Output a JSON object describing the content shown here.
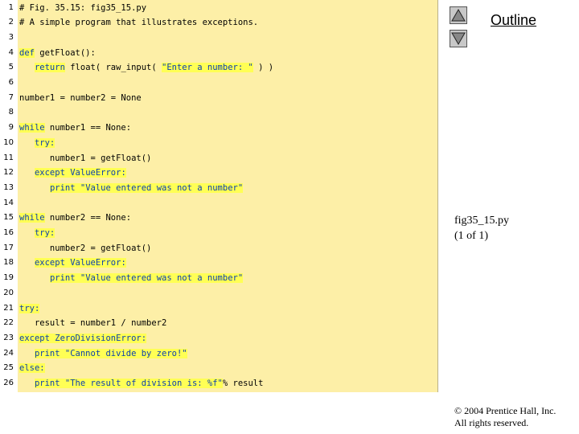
{
  "code_lines": [
    {
      "n": "1",
      "tokens": [
        {
          "t": "# Fig. 35.15: fig35_15.py",
          "c": "comment"
        }
      ]
    },
    {
      "n": "2",
      "tokens": [
        {
          "t": "# A simple program that illustrates exceptions.",
          "c": "comment"
        }
      ]
    },
    {
      "n": "3",
      "tokens": []
    },
    {
      "n": "4",
      "tokens": [
        {
          "t": "def",
          "c": "kw"
        },
        {
          "t": " getFloat():",
          "c": "plain"
        }
      ]
    },
    {
      "n": "5",
      "tokens": [
        {
          "t": "   ",
          "c": "plain"
        },
        {
          "t": "return",
          "c": "kw"
        },
        {
          "t": " float( raw_input( ",
          "c": "plain"
        },
        {
          "t": "\"Enter a number: \"",
          "c": "str"
        },
        {
          "t": " ) )",
          "c": "plain"
        }
      ]
    },
    {
      "n": "6",
      "tokens": []
    },
    {
      "n": "7",
      "tokens": [
        {
          "t": "number1 = number2 = None",
          "c": "plain"
        }
      ]
    },
    {
      "n": "8",
      "tokens": []
    },
    {
      "n": "9",
      "tokens": [
        {
          "t": "while",
          "c": "kw"
        },
        {
          "t": " number1 == None:",
          "c": "plain"
        }
      ]
    },
    {
      "n": "10",
      "tokens": [
        {
          "t": "   ",
          "c": "plain"
        },
        {
          "t": "try:",
          "c": "kw"
        }
      ]
    },
    {
      "n": "11",
      "tokens": [
        {
          "t": "      number1 = getFloat()",
          "c": "plain"
        }
      ]
    },
    {
      "n": "12",
      "tokens": [
        {
          "t": "   ",
          "c": "plain"
        },
        {
          "t": "except",
          "c": "kw"
        },
        {
          "t": " ValueError:",
          "c": "kw"
        }
      ]
    },
    {
      "n": "13",
      "tokens": [
        {
          "t": "      ",
          "c": "plain"
        },
        {
          "t": "print",
          "c": "kw"
        },
        {
          "t": " \"Value entered was not a number\"",
          "c": "str"
        }
      ]
    },
    {
      "n": "14",
      "tokens": []
    },
    {
      "n": "15",
      "tokens": [
        {
          "t": "while",
          "c": "kw"
        },
        {
          "t": " number2 == None:",
          "c": "plain"
        }
      ]
    },
    {
      "n": "16",
      "tokens": [
        {
          "t": "   ",
          "c": "plain"
        },
        {
          "t": "try:",
          "c": "kw"
        }
      ]
    },
    {
      "n": "17",
      "tokens": [
        {
          "t": "      number2 = getFloat()",
          "c": "plain"
        }
      ]
    },
    {
      "n": "18",
      "tokens": [
        {
          "t": "   ",
          "c": "plain"
        },
        {
          "t": "except",
          "c": "kw"
        },
        {
          "t": " ValueError:",
          "c": "kw"
        }
      ]
    },
    {
      "n": "19",
      "tokens": [
        {
          "t": "      ",
          "c": "plain"
        },
        {
          "t": "print",
          "c": "kw"
        },
        {
          "t": " \"Value entered was not a number\"",
          "c": "str"
        }
      ]
    },
    {
      "n": "20",
      "tokens": []
    },
    {
      "n": "21",
      "tokens": [
        {
          "t": "try:",
          "c": "kw"
        }
      ]
    },
    {
      "n": "22",
      "tokens": [
        {
          "t": "   result = number1 / number2",
          "c": "plain"
        }
      ]
    },
    {
      "n": "23",
      "tokens": [
        {
          "t": "except",
          "c": "kw"
        },
        {
          "t": " ZeroDivisionError:",
          "c": "kw"
        }
      ]
    },
    {
      "n": "24",
      "tokens": [
        {
          "t": "   ",
          "c": "plain"
        },
        {
          "t": "print",
          "c": "kw"
        },
        {
          "t": " \"Cannot divide by zero!\"",
          "c": "str"
        }
      ]
    },
    {
      "n": "25",
      "tokens": [
        {
          "t": "else:",
          "c": "kw"
        }
      ]
    },
    {
      "n": "26",
      "tokens": [
        {
          "t": "   ",
          "c": "plain"
        },
        {
          "t": "print",
          "c": "kw"
        },
        {
          "t": " \"The result of division is: %f\"",
          "c": "str"
        },
        {
          "t": "% result",
          "c": "plain"
        }
      ]
    }
  ],
  "outline": {
    "label": "Outline"
  },
  "nav": {
    "up_icon": "triangle-up-icon",
    "down_icon": "triangle-down-icon"
  },
  "file": {
    "name": "fig35_15.py",
    "pages": "(1 of 1)"
  },
  "copyright": {
    "line1": "© 2004 Prentice Hall, Inc.",
    "line2": "All rights reserved."
  },
  "colors": {
    "panel": "#fdefa7",
    "keyword": "#0a3fae",
    "highlight": "#ffff55"
  }
}
